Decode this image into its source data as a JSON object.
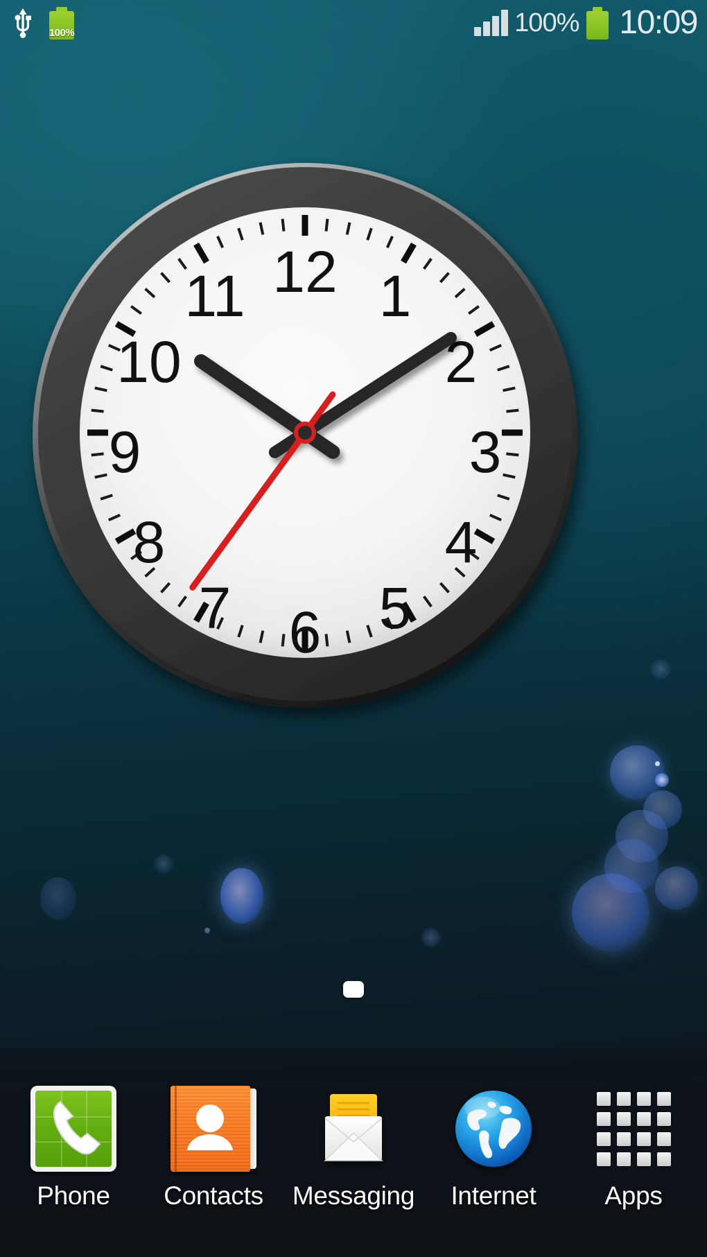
{
  "status_bar": {
    "usb_icon": "usb-icon",
    "charging_battery_icon": "battery-charging-icon",
    "charging_battery_percent": "100%",
    "signal_icon": "signal-bars-icon",
    "battery_percent_text": "100%",
    "battery_icon": "battery-icon",
    "clock": "10:09"
  },
  "clock_widget": {
    "name": "analog-clock-widget",
    "numerals": [
      "1",
      "2",
      "3",
      "4",
      "5",
      "6",
      "7",
      "8",
      "9",
      "10",
      "11",
      "12"
    ],
    "hour": 10,
    "minute": 9,
    "second": 36,
    "hour_hand_angle": 304.5,
    "minute_hand_angle": 57,
    "second_hand_angle": 216,
    "face_color": "#f4f4f4",
    "bezel_color": "#3d3d3d",
    "numeral_color": "#0d0d0d",
    "hand_color": "#262626",
    "second_hand_color": "#d81f1f"
  },
  "page_indicator": {
    "pages": 1,
    "active": 0
  },
  "dock": {
    "items": [
      {
        "label": "Phone",
        "icon": "phone-icon",
        "color": "#63ad10"
      },
      {
        "label": "Contacts",
        "icon": "contacts-icon",
        "color": "#f4761d"
      },
      {
        "label": "Messaging",
        "icon": "messaging-icon",
        "color": "#f5c016"
      },
      {
        "label": "Internet",
        "icon": "internet-icon",
        "color": "#1d8fd6"
      },
      {
        "label": "Apps",
        "icon": "apps-grid-icon",
        "color": "#e3e6e7"
      }
    ]
  },
  "wallpaper": {
    "name": "bokeh-wallpaper",
    "top_color": "#135e70",
    "bottom_color": "#0e1318",
    "bokeh_color": "#4a7fe0"
  }
}
